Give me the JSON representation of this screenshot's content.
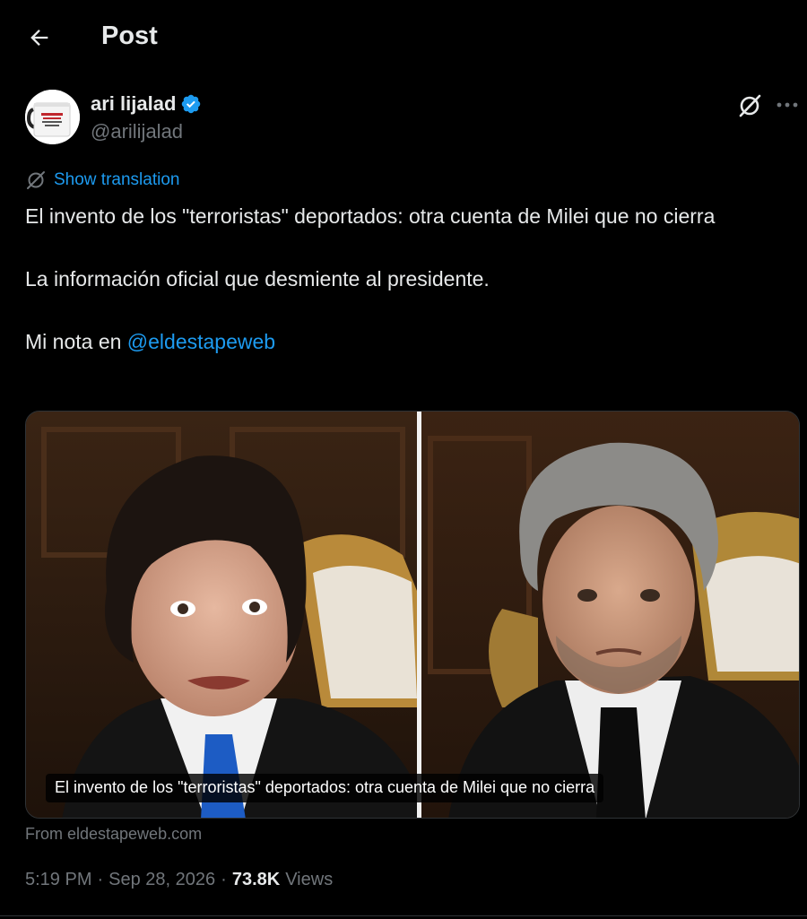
{
  "header": {
    "title": "Post"
  },
  "author": {
    "display_name": "ari lijalad",
    "handle": "@arilijalad",
    "avatar_text": "PAPERS"
  },
  "translation": {
    "label": "Show translation"
  },
  "tweet": {
    "paragraph_1": "El invento de los \"terroristas\" deportados: otra cuenta de Milei que no cierra",
    "paragraph_2": "La información oficial que desmiente al presidente.",
    "paragraph_3_prefix": "Mi nota en ",
    "mention": "@eldestapeweb"
  },
  "link_card": {
    "caption": "El invento de los \"terroristas\" deportados: otra cuenta de Milei que no cierra",
    "source": "From eldestapeweb.com"
  },
  "meta": {
    "time": "5:19 PM",
    "date": "Sep 28, 2026",
    "separator": "·",
    "views_count": "73.8K",
    "views_label": "Views"
  },
  "colors": {
    "accent": "#1d9bf0",
    "text": "#e7e9ea",
    "muted": "#71767b",
    "background": "#000000"
  },
  "icons": {
    "back": "arrow-left-icon",
    "verified": "verified-badge-icon",
    "grok": "grok-icon",
    "more": "more-horizontal-icon",
    "translate": "translate-icon"
  }
}
